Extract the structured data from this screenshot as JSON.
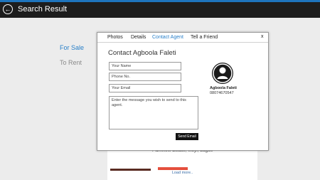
{
  "header": {
    "title": "Search Result",
    "back_icon": "back-arrow-icon"
  },
  "sidebar": {
    "items": [
      {
        "label": "For Sale",
        "active": true
      },
      {
        "label": "To Rent",
        "active": false
      }
    ]
  },
  "background_listing": {
    "address": "Parkview Estate, Ikoyi, Lagos",
    "load_more": "Load more.."
  },
  "modal": {
    "tabs": [
      {
        "label": "Photos",
        "active": false
      },
      {
        "label": "Details",
        "active": false
      },
      {
        "label": "Contact Agent",
        "active": true
      },
      {
        "label": "Tell a Friend",
        "active": false
      }
    ],
    "close_label": "x",
    "contact_title": "Contact  Agboola Faleti",
    "form": {
      "name_value": "Your Name",
      "phone_value": "Phone No.",
      "email_value": "Your Email",
      "message_value": "Enter the message you wish to send to this agent."
    },
    "send_label": "Send Email",
    "agent": {
      "name": "Agboola Faleti",
      "phone": "08074670547",
      "avatar_icon": "user-avatar-icon"
    }
  },
  "colors": {
    "accent": "#2a80c9",
    "titlebar": "#1d1d1d",
    "background": "#ececec"
  }
}
